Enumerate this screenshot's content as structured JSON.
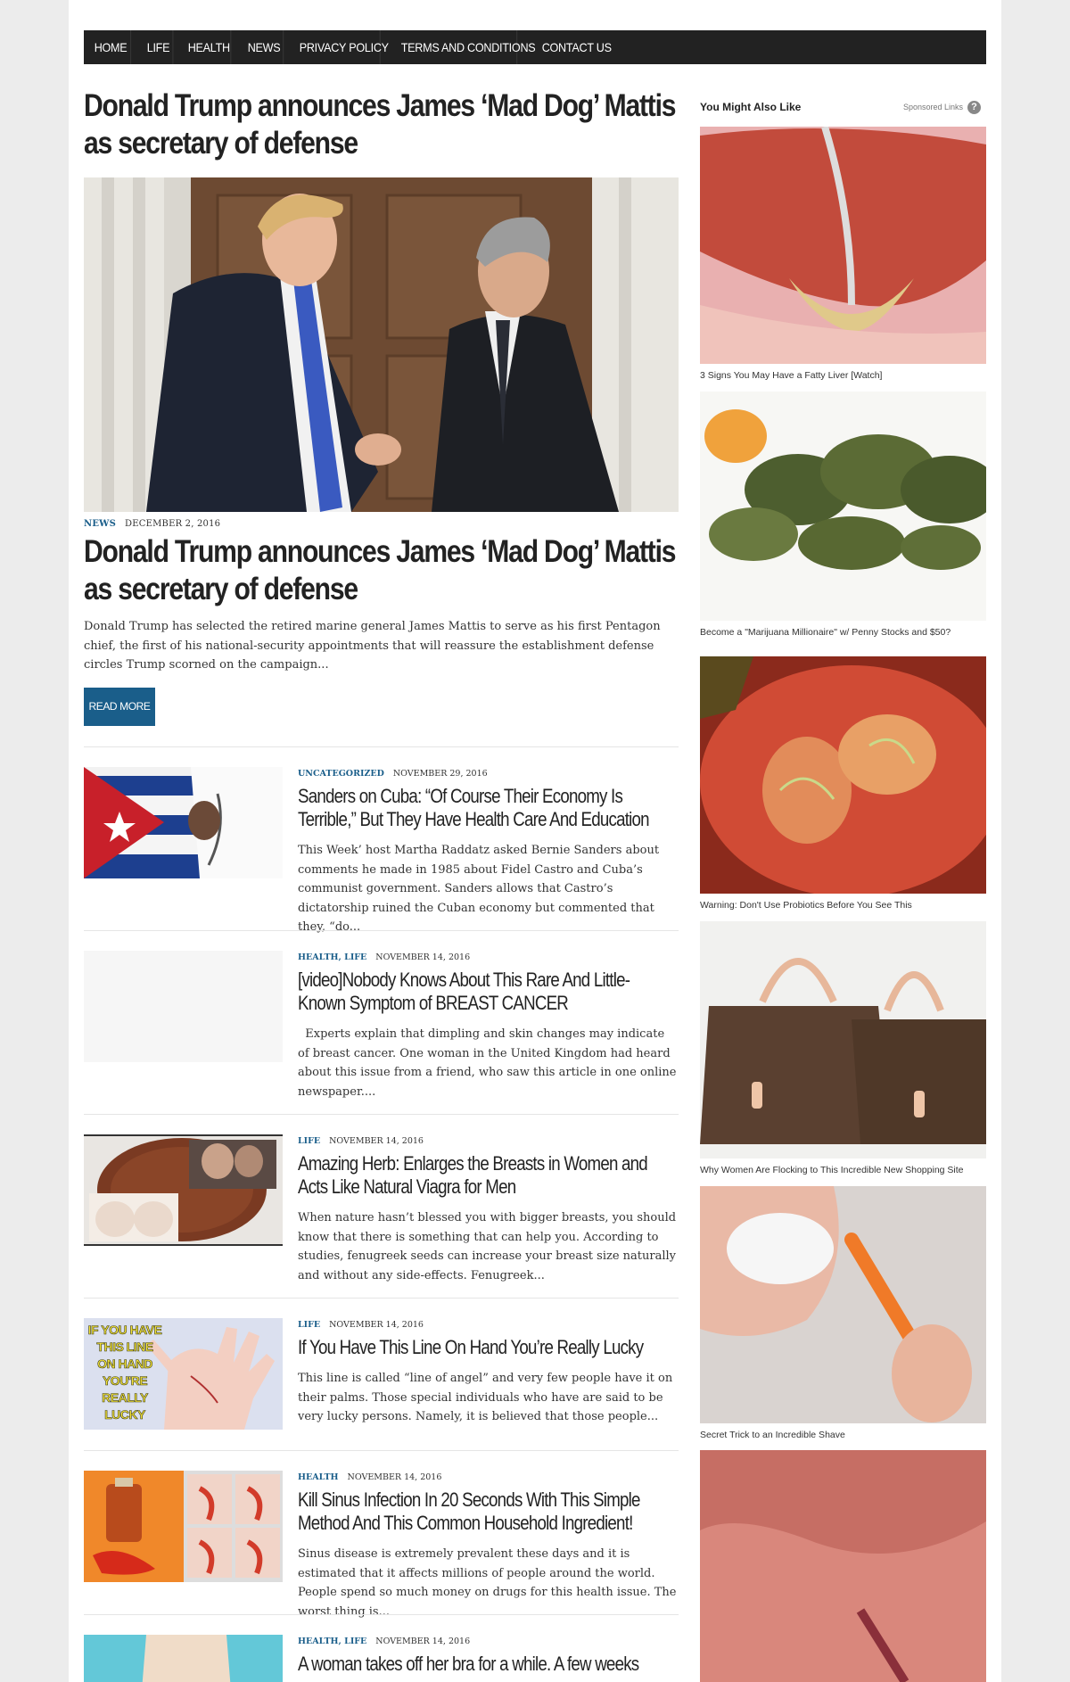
{
  "nav": {
    "items": [
      "HOME",
      "LIFE",
      "HEALTH",
      "NEWS",
      "PRIVACY POLICY",
      "TERMS AND CONDITIONS",
      "CONTACT US"
    ]
  },
  "article": {
    "page_title": "Donald Trump announces James ‘Mad Dog’ Mattis as secretary of defense",
    "category": "NEWS",
    "date": "DECEMBER 2, 2016",
    "title": "Donald Trump announces James ‘Mad Dog’ Mattis as secretary of defense",
    "excerpt": "Donald Trump has selected the retired marine general James Mattis to serve as his first Pentagon chief, the first of his national-security appointments that will reassure the establishment defense circles Trump scorned on the campaign...",
    "read_more": "READ MORE"
  },
  "posts": [
    {
      "category": "UNCATEGORIZED",
      "date": "NOVEMBER 29, 2016",
      "title": "Sanders on Cuba: “Of Course Their Economy Is Terrible,” But They Have Health Care And Education",
      "excerpt": "This Week’ host Martha Raddatz asked Bernie Sanders about comments he made in 1985 about Fidel Castro and Cuba’s communist government. Sanders allows that Castro’s dictatorship ruined the Cuban economy but commented that they, “do..."
    },
    {
      "category": "HEALTH, LIFE",
      "date": "NOVEMBER 14, 2016",
      "title": "[video]Nobody Knows About This Rare And Little-Known Symptom of BREAST CANCER",
      "excerpt": "  Experts explain that dimpling and skin changes may indicate of breast cancer. One woman in the United Kingdom had heard about this issue from a friend, who saw this article in one online newspaper...."
    },
    {
      "category": "LIFE",
      "date": "NOVEMBER 14, 2016",
      "title": "Amazing Herb: Enlarges the Breasts in Women and Acts Like Natural Viagra for Men",
      "excerpt": "When nature hasn’t blessed you with bigger breasts, you should know that there is something that can help you. According to studies, fenugreek seeds can increase your breast size naturally and without any side-effects. Fenugreek..."
    },
    {
      "category": "LIFE",
      "date": "NOVEMBER 14, 2016",
      "title": "If You Have This Line On Hand You’re Really Lucky",
      "excerpt": "This line is called “line of angel” and very few people have it on their palms. Those special individuals who have are said to be very lucky persons. Namely, it is believed that those people...",
      "thumb_text": [
        "IF YOU HAVE",
        "THIS LINE",
        "ON HAND",
        "YOU'RE",
        "REALLY",
        "LUCKY"
      ]
    },
    {
      "category": "HEALTH",
      "date": "NOVEMBER 14, 2016",
      "title": "Kill Sinus Infection In 20 Seconds With This Simple Method And This Common Household Ingredient!",
      "excerpt": "Sinus disease is extremely prevalent these days and it is estimated that it affects millions of people around the world.  People spend so much money on drugs for this health issue. The worst thing is..."
    },
    {
      "category": "HEALTH, LIFE",
      "date": "NOVEMBER 14, 2016",
      "title": "A woman takes off her bra for a while. A few weeks",
      "excerpt": ""
    }
  ],
  "sidebar": {
    "heading": "You Might Also Like",
    "sponsored": "Sponsored Links",
    "help": "?",
    "ads": [
      {
        "caption": "3 Signs You May Have a Fatty Liver [Watch]"
      },
      {
        "caption": "Become a \"Marijuana Millionaire\" w/ Penny Stocks and $50?"
      },
      {
        "caption": "Warning: Don't Use Probiotics Before You See This"
      },
      {
        "caption": "Why Women Are Flocking to This Incredible New Shopping Site"
      },
      {
        "caption": "Secret Trick to an Incredible Shave"
      },
      {
        "caption": ""
      }
    ]
  }
}
